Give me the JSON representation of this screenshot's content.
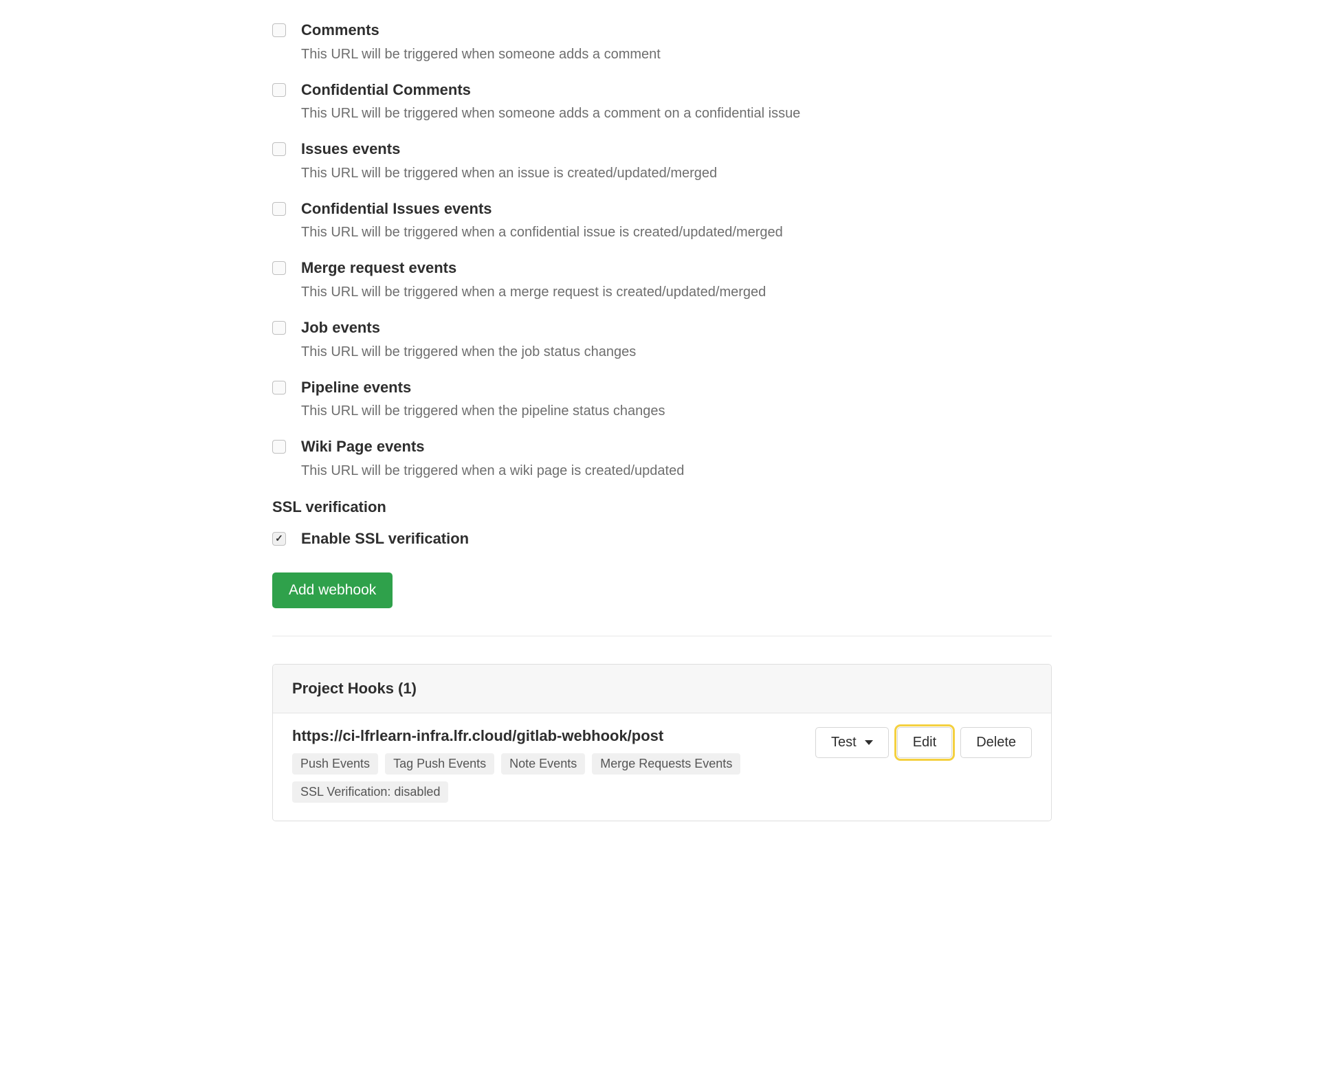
{
  "triggers": [
    {
      "title": "Comments",
      "desc": "This URL will be triggered when someone adds a comment",
      "checked": false
    },
    {
      "title": "Confidential Comments",
      "desc": "This URL will be triggered when someone adds a comment on a confidential issue",
      "checked": false
    },
    {
      "title": "Issues events",
      "desc": "This URL will be triggered when an issue is created/updated/merged",
      "checked": false
    },
    {
      "title": "Confidential Issues events",
      "desc": "This URL will be triggered when a confidential issue is created/updated/merged",
      "checked": false
    },
    {
      "title": "Merge request events",
      "desc": "This URL will be triggered when a merge request is created/updated/merged",
      "checked": false
    },
    {
      "title": "Job events",
      "desc": "This URL will be triggered when the job status changes",
      "checked": false
    },
    {
      "title": "Pipeline events",
      "desc": "This URL will be triggered when the pipeline status changes",
      "checked": false
    },
    {
      "title": "Wiki Page events",
      "desc": "This URL will be triggered when a wiki page is created/updated",
      "checked": false
    }
  ],
  "ssl": {
    "section_label": "SSL verification",
    "enable_label": "Enable SSL verification",
    "checked": true
  },
  "buttons": {
    "add_webhook": "Add webhook",
    "test": "Test",
    "edit": "Edit",
    "delete": "Delete"
  },
  "hooks_panel": {
    "title": "Project Hooks (1)"
  },
  "hook": {
    "url": "https://ci-lfrlearn-infra.lfr.cloud/gitlab-webhook/post",
    "badges": [
      "Push Events",
      "Tag Push Events",
      "Note Events",
      "Merge Requests Events",
      "SSL Verification: disabled"
    ]
  }
}
